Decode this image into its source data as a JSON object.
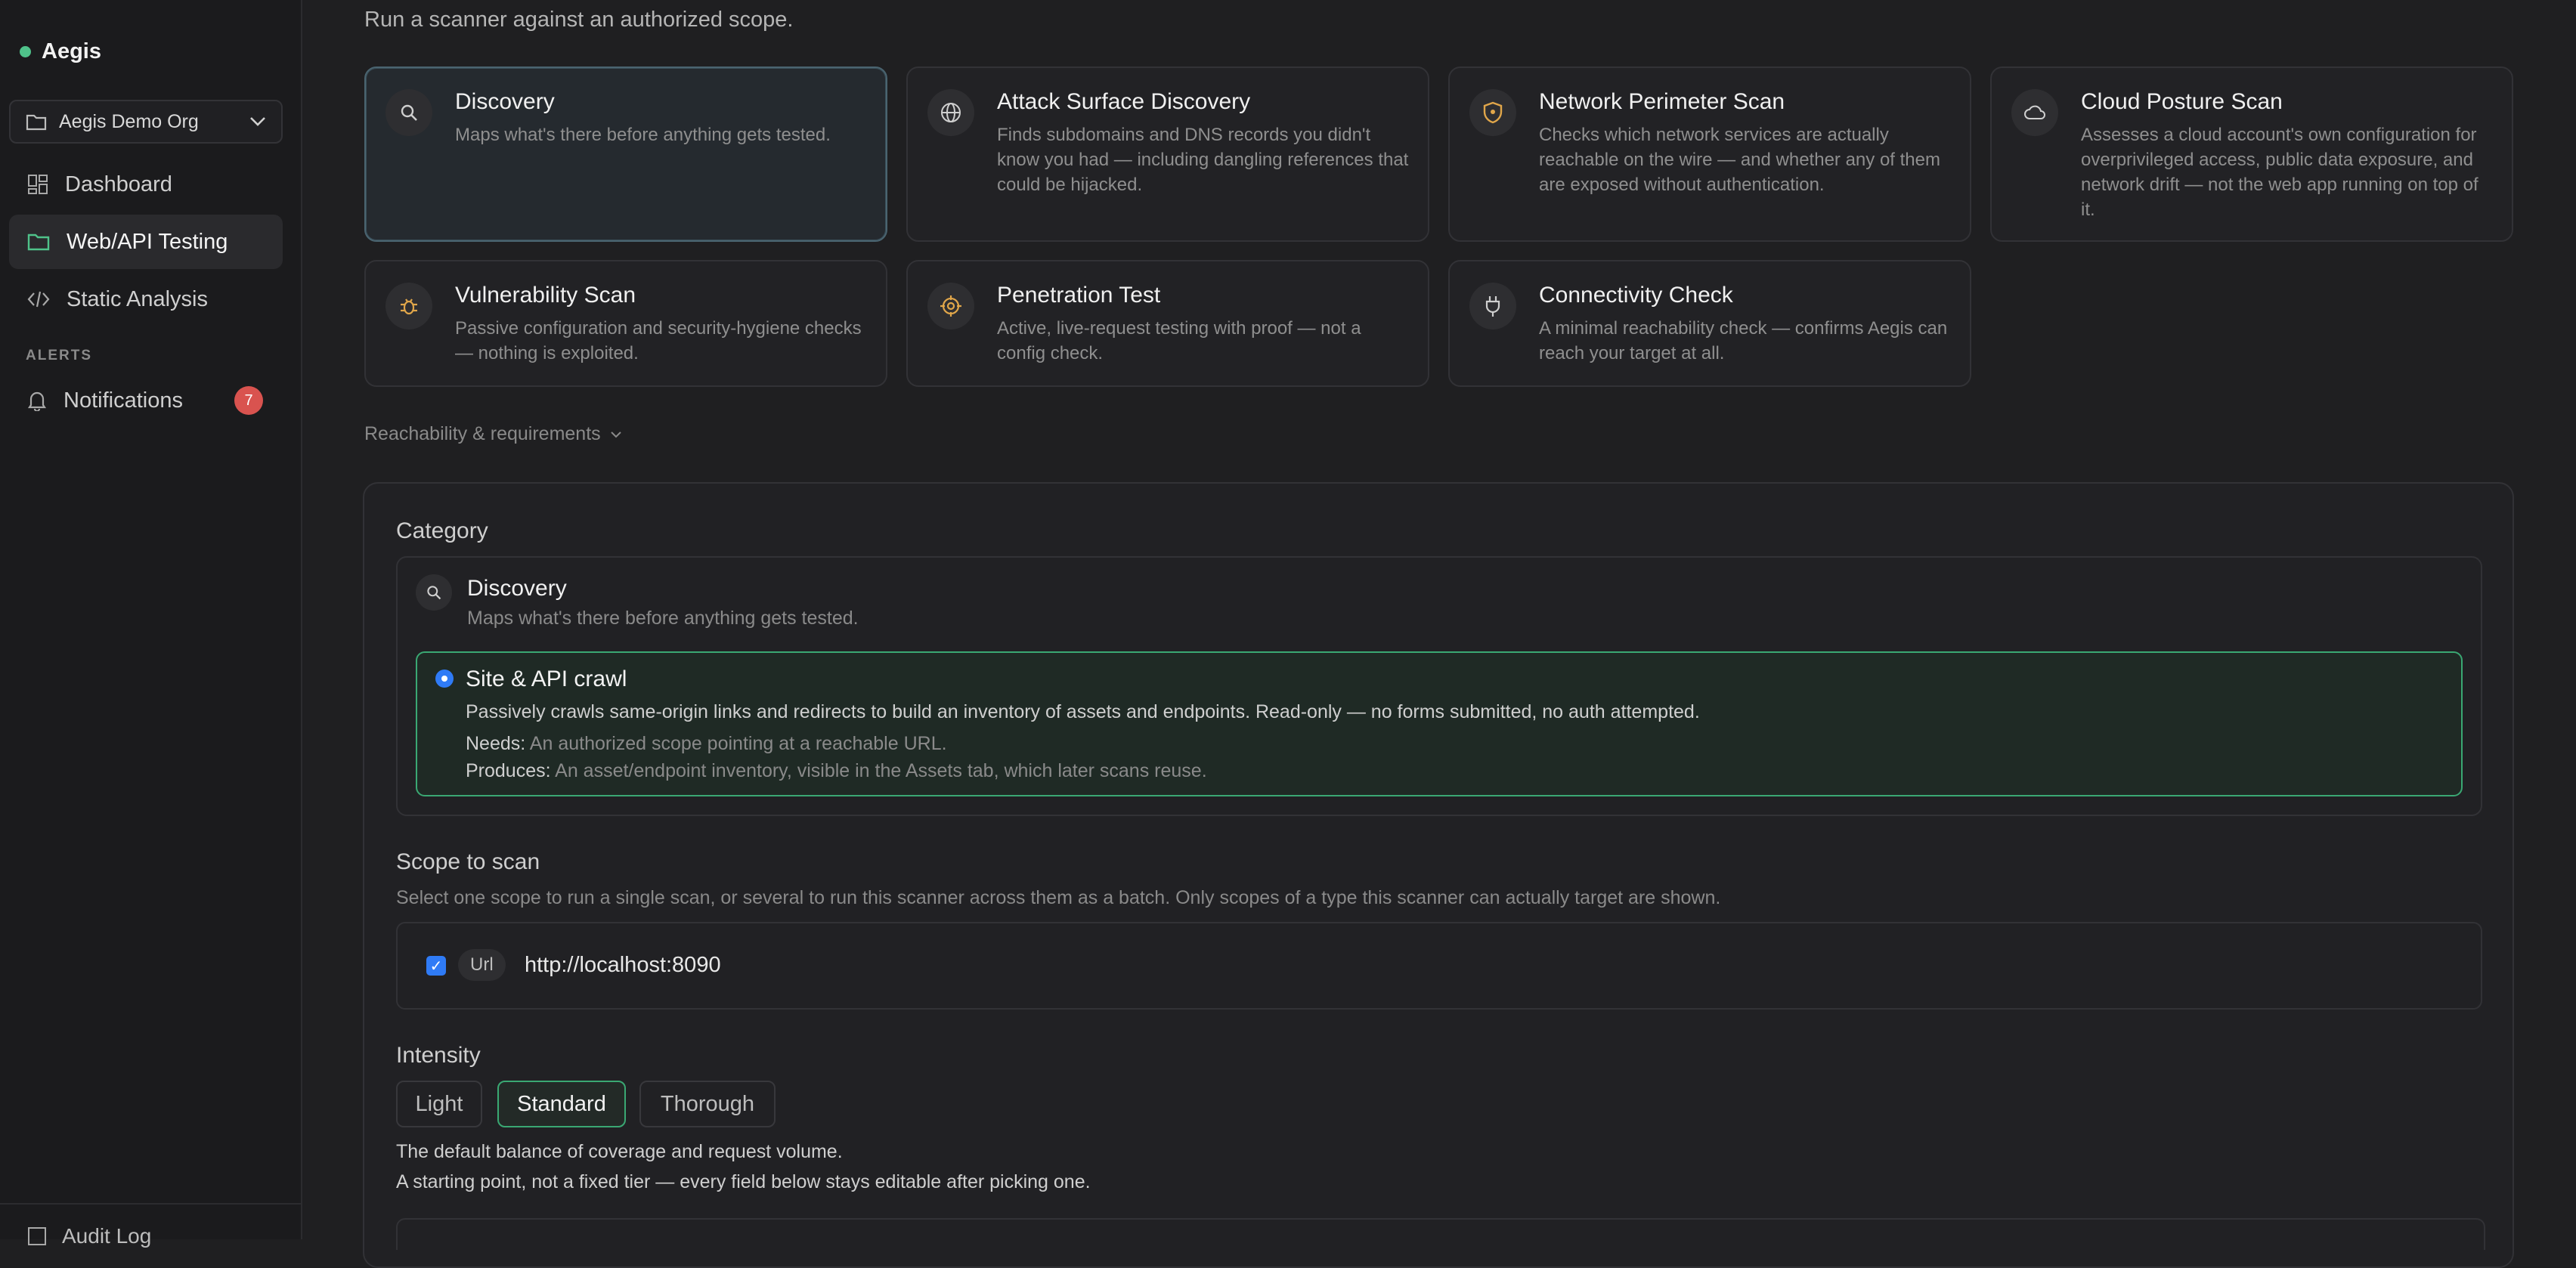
{
  "sidebar": {
    "brand": "Aegis",
    "org": "Aegis Demo Org",
    "items": [
      {
        "label": "Dashboard"
      },
      {
        "label": "Web/API Testing"
      },
      {
        "label": "Static Analysis"
      }
    ],
    "alerts_section": "ALERTS",
    "notifications": {
      "label": "Notifications",
      "count": "7"
    },
    "bottom_item": "Audit Log"
  },
  "main": {
    "subtitle": "Run a scanner against an authorized scope.",
    "scanners": [
      {
        "title": "Discovery",
        "desc": "Maps what's there before anything gets tested.",
        "icon": "search-icon"
      },
      {
        "title": "Attack Surface Discovery",
        "desc": "Finds subdomains and DNS records you didn't know you had — including dangling references that could be hijacked.",
        "icon": "globe-icon"
      },
      {
        "title": "Network Perimeter Scan",
        "desc": "Checks which network services are actually reachable on the wire — and whether any of them are exposed without authentication.",
        "icon": "shield-icon"
      },
      {
        "title": "Cloud Posture Scan",
        "desc": "Assesses a cloud account's own configuration for overprivileged access, public data exposure, and network drift — not the web app running on top of it.",
        "icon": "cloud-icon"
      },
      {
        "title": "Vulnerability Scan",
        "desc": "Passive configuration and security-hygiene checks — nothing is exploited.",
        "icon": "bug-icon"
      },
      {
        "title": "Penetration Test",
        "desc": "Active, live-request testing with proof — not a config check.",
        "icon": "target-icon"
      },
      {
        "title": "Connectivity Check",
        "desc": "A minimal reachability check — confirms Aegis can reach your target at all.",
        "icon": "plug-icon"
      }
    ],
    "reachability": "Reachability & requirements",
    "category": {
      "label": "Category",
      "title": "Discovery",
      "desc": "Maps what's there before anything gets tested.",
      "option": {
        "title": "Site & API crawl",
        "desc": "Passively crawls same-origin links and redirects to build an inventory of assets and endpoints. Read-only — no forms submitted, no auth attempted.",
        "needs_label": "Needs:",
        "needs": "An authorized scope pointing at a reachable URL.",
        "produces_label": "Produces:",
        "produces": "An asset/endpoint inventory, visible in the Assets tab, which later scans reuse."
      }
    },
    "scope": {
      "label": "Scope to scan",
      "help": "Select one scope to run a single scan, or several to run this scanner across them as a batch. Only scopes of a type this scanner can actually target are shown.",
      "item_type": "Url",
      "item_url": "http://localhost:8090"
    },
    "intensity": {
      "label": "Intensity",
      "options": [
        "Light",
        "Standard",
        "Thorough"
      ],
      "selected": "Standard",
      "help1": "The default balance of coverage and request volume.",
      "help2": "A starting point, not a fixed tier — every field below stays editable after picking one."
    }
  },
  "colors": {
    "accent": "#3aa873",
    "badge": "#d9534f",
    "checkbox": "#2f7bf6",
    "selected_card_border": "#4a6470"
  }
}
